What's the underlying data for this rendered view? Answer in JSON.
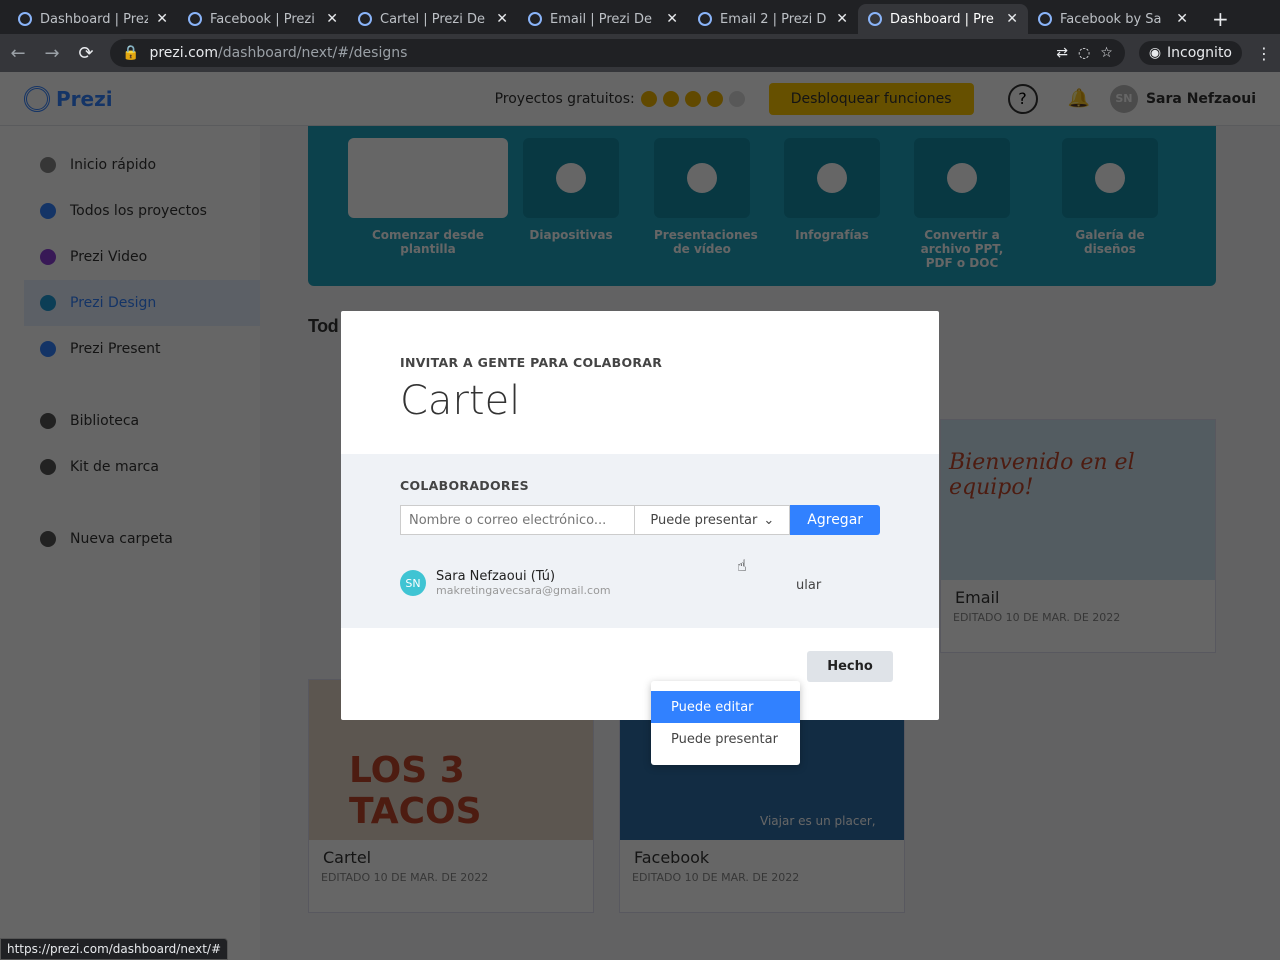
{
  "browser": {
    "tabs": [
      {
        "title": "Dashboard | Prezi"
      },
      {
        "title": "Facebook | Prezi"
      },
      {
        "title": "Cartel | Prezi De"
      },
      {
        "title": "Email | Prezi De"
      },
      {
        "title": "Email 2 | Prezi D"
      },
      {
        "title": "Dashboard | Pre",
        "active": true
      },
      {
        "title": "Facebook by Sa"
      }
    ],
    "url_host": "prezi.com",
    "url_path": "/dashboard/next/#/designs",
    "profile": "Incognito",
    "status_url": "https://prezi.com/dashboard/next/#"
  },
  "header": {
    "logo": "Prezi",
    "free_projects": "Proyectos gratuitos:",
    "unlock": "Desbloquear funciones",
    "user_initials": "SN",
    "user_name": "Sara Nefzaoui"
  },
  "sidebar": {
    "items": [
      {
        "label": "Inicio rápido",
        "color": "#888"
      },
      {
        "label": "Todos los proyectos",
        "color": "#3181ff"
      },
      {
        "label": "Prezi Video",
        "color": "#8b3fd6"
      },
      {
        "label": "Prezi Design",
        "color": "#1f9bd6",
        "active": true
      },
      {
        "label": "Prezi Present",
        "color": "#3181ff"
      },
      {
        "label": "Biblioteca",
        "color": "#555"
      },
      {
        "label": "Kit de marca",
        "color": "#555"
      },
      {
        "label": "Nueva carpeta",
        "color": "#555"
      }
    ]
  },
  "banner": {
    "cards": [
      "Comenzar desde plantilla",
      "Diapositivas",
      "Presentaciones de vídeo",
      "Infografías",
      "Convertir a archivo PPT, PDF o DOC",
      "Galería de diseños"
    ]
  },
  "section_title": "Tod",
  "projects": [
    {
      "name": "Email",
      "edited": "EDITADO 10 DE MAR. DE 2022",
      "thumb_text": "Bienvenido en el equipo!"
    },
    {
      "name": "Cartel",
      "edited": "EDITADO 10 DE MAR. DE 2022",
      "thumb_text": "LOS 3 TACOS"
    },
    {
      "name": "Facebook",
      "edited": "EDITADO 10 DE MAR. DE 2022",
      "thumb_text": "Viajar es un placer,"
    }
  ],
  "modal": {
    "subtitle": "INVITAR A GENTE PARA COLABORAR",
    "title": "Cartel",
    "collab_label": "COLABORADORES",
    "input_placeholder": "Nombre o correo electrónico...",
    "permission": "Puede presentar",
    "add": "Agregar",
    "options": [
      "Puede editar",
      "Puede presentar"
    ],
    "collaborator": {
      "initials": "SN",
      "name": "Sara Nefzaoui (Tú)",
      "email": "makretingavecsara@gmail.com",
      "role_partial": "ular"
    },
    "done": "Hecho"
  }
}
